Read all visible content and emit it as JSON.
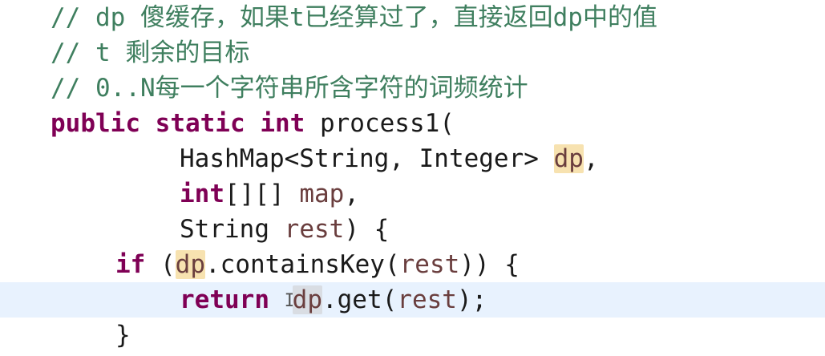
{
  "editor": {
    "lines": [
      {
        "text": "// dp 傻缓存，如果t已经算过了，直接返回dp中的值"
      },
      {
        "text": "// t 剩余的目标"
      },
      {
        "text": "// 0..N每一个字符串所含字符的词频统计"
      },
      {
        "kw1": "public",
        "kw2": "static",
        "kw3": "int",
        "name": "process1("
      },
      {
        "type": "HashMap<String, Integer>",
        "param": "dp",
        "punct": ","
      },
      {
        "kw": "int",
        "brackets": "[][]",
        "param": "map",
        "punct": ","
      },
      {
        "type": "String",
        "param": "rest",
        "punct": ") {"
      },
      {
        "kw": "if",
        "open": "(",
        "obj": "dp",
        "method": ".containsKey(",
        "arg": "rest",
        "close": ")) {"
      },
      {
        "kw": "return",
        "obj": "dp",
        "method": ".get(",
        "arg": "rest",
        "close": ");"
      },
      {
        "text": "}"
      }
    ],
    "current_line_index": 8
  },
  "colors": {
    "comment": "#3f7f5f",
    "keyword": "#7f0055",
    "field": "#6a3e3e",
    "occurrence_highlight": "#f7e2b0",
    "current_line": "#e8f2fe"
  }
}
